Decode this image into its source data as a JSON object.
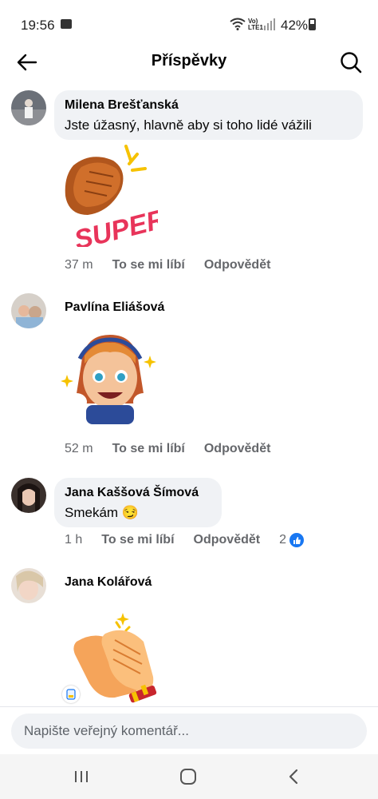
{
  "status_bar": {
    "time": "19:56",
    "network": "Vo) LTE1",
    "battery": "42%"
  },
  "header": {
    "title": "Příspěvky"
  },
  "comments": [
    {
      "author": "Milena Brešťanská",
      "text": "Jste úžasný, hlavně aby si toho lidé vážili",
      "sticker": "super-clapping-hands-sticker",
      "time": "37 m",
      "like": "To se mi líbí",
      "reply": "Odpovědět"
    },
    {
      "author": "Pavlína Eliášová",
      "sticker": "girl-thumbs-up-sticker",
      "time": "52 m",
      "like": "To se mi líbí",
      "reply": "Odpovědět"
    },
    {
      "author": "Jana Kaššová Šímová",
      "text": "Smekám 😏",
      "time": "1 h",
      "like": "To se mi líbí",
      "reply": "Odpovědět",
      "reactions": "2"
    },
    {
      "author": "Jana Kolářová",
      "sticker": "clapping-hands-sticker"
    }
  ],
  "composer": {
    "placeholder": "Napište veřejný komentář..."
  },
  "colors": {
    "bubble": "#f0f2f5",
    "meta_text": "#65676b",
    "like_blue": "#1877f2"
  }
}
